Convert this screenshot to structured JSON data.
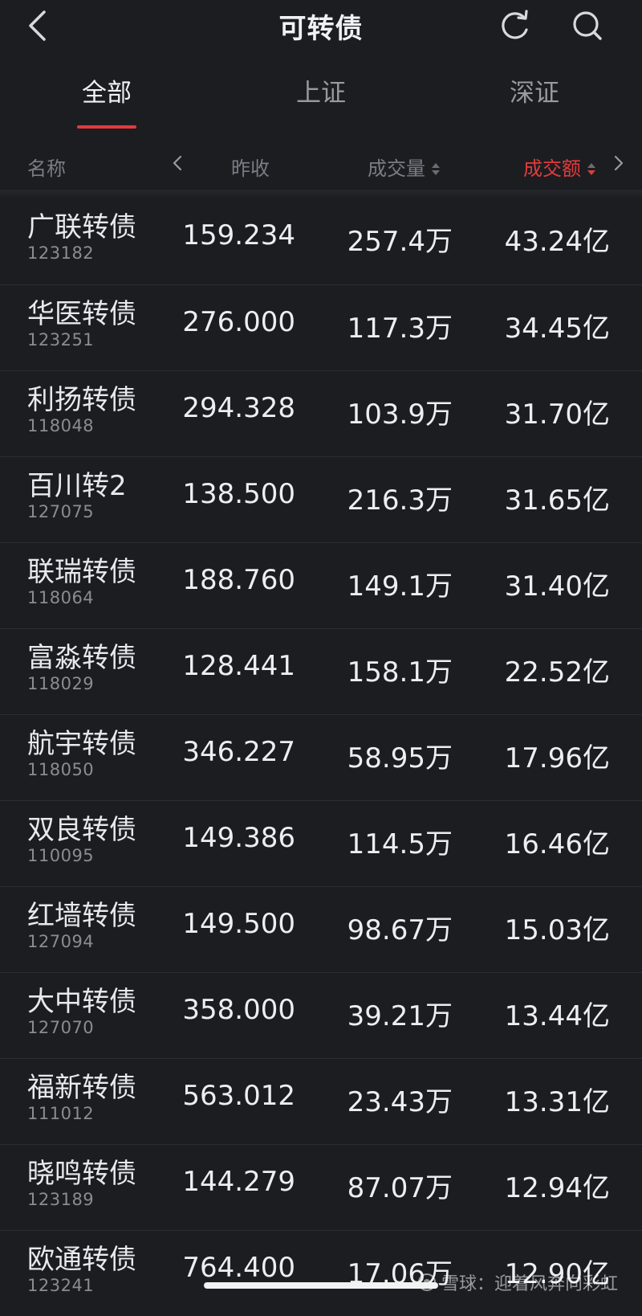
{
  "header": {
    "title": "可转债"
  },
  "tabs": [
    {
      "label": "全部",
      "active": true
    },
    {
      "label": "上证",
      "active": false
    },
    {
      "label": "深证",
      "active": false
    }
  ],
  "columns": {
    "name": "名称",
    "prev_close": "昨收",
    "volume": "成交量",
    "amount": "成交额"
  },
  "colors": {
    "accent": "#e23b3b",
    "background": "#1c1d21"
  },
  "rows": [
    {
      "name": "广联转债",
      "code": "123182",
      "prev_close": "159.234",
      "volume": "257.4万",
      "amount": "43.24亿"
    },
    {
      "name": "华医转债",
      "code": "123251",
      "prev_close": "276.000",
      "volume": "117.3万",
      "amount": "34.45亿"
    },
    {
      "name": "利扬转债",
      "code": "118048",
      "prev_close": "294.328",
      "volume": "103.9万",
      "amount": "31.70亿"
    },
    {
      "name": "百川转2",
      "code": "127075",
      "prev_close": "138.500",
      "volume": "216.3万",
      "amount": "31.65亿"
    },
    {
      "name": "联瑞转债",
      "code": "118064",
      "prev_close": "188.760",
      "volume": "149.1万",
      "amount": "31.40亿"
    },
    {
      "name": "富淼转债",
      "code": "118029",
      "prev_close": "128.441",
      "volume": "158.1万",
      "amount": "22.52亿"
    },
    {
      "name": "航宇转债",
      "code": "118050",
      "prev_close": "346.227",
      "volume": "58.95万",
      "amount": "17.96亿"
    },
    {
      "name": "双良转债",
      "code": "110095",
      "prev_close": "149.386",
      "volume": "114.5万",
      "amount": "16.46亿"
    },
    {
      "name": "红墙转债",
      "code": "127094",
      "prev_close": "149.500",
      "volume": "98.67万",
      "amount": "15.03亿"
    },
    {
      "name": "大中转债",
      "code": "127070",
      "prev_close": "358.000",
      "volume": "39.21万",
      "amount": "13.44亿"
    },
    {
      "name": "福新转债",
      "code": "111012",
      "prev_close": "563.012",
      "volume": "23.43万",
      "amount": "13.31亿"
    },
    {
      "name": "晓鸣转债",
      "code": "123189",
      "prev_close": "144.279",
      "volume": "87.07万",
      "amount": "12.94亿"
    },
    {
      "name": "欧通转债",
      "code": "123241",
      "prev_close": "764.400",
      "volume": "17.06万",
      "amount": "12.90亿"
    }
  ],
  "watermark": "雪球：迎着风奔向彩虹"
}
